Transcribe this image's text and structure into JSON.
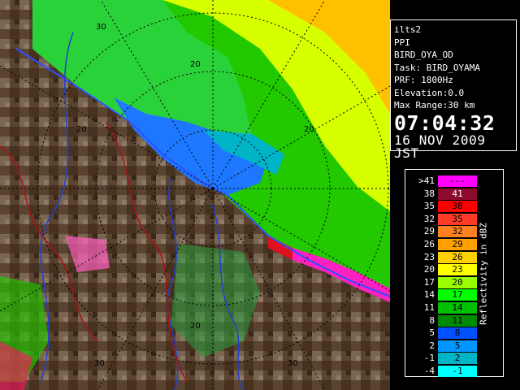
{
  "info_panel": {
    "site": "ilts2",
    "scan_type": "PPI",
    "product": "BIRD_OYA_OD",
    "task": "Task: BIRD_OYAMA",
    "prf": "PRF: 1800Hz",
    "elevation": "Elevation:0.0",
    "max_range": "Max Range:30 km",
    "time": "07:04:32",
    "date": "16 NOV 2009 JST"
  },
  "legend": {
    "title": "Reflectivity in dBZ",
    "rows": [
      {
        "low": ">41",
        "high": "---",
        "color": "#ff00ff",
        "text": "#000000"
      },
      {
        "low": "38",
        "high": "41",
        "color": "#8c0a2e",
        "text": "#ffffff"
      },
      {
        "low": "35",
        "high": "38",
        "color": "#ff0000",
        "text": "#000000"
      },
      {
        "low": "32",
        "high": "35",
        "color": "#ff3c28",
        "text": "#000000"
      },
      {
        "low": "29",
        "high": "32",
        "color": "#ff8020",
        "text": "#000000"
      },
      {
        "low": "26",
        "high": "29",
        "color": "#ffa000",
        "text": "#000000"
      },
      {
        "low": "23",
        "high": "26",
        "color": "#ffd000",
        "text": "#000000"
      },
      {
        "low": "20",
        "high": "23",
        "color": "#ffff00",
        "text": "#000000"
      },
      {
        "low": "17",
        "high": "20",
        "color": "#9aff00",
        "text": "#000000"
      },
      {
        "low": "14",
        "high": "17",
        "color": "#00ff00",
        "text": "#000000"
      },
      {
        "low": "11",
        "high": "14",
        "color": "#00c000",
        "text": "#000000"
      },
      {
        "low": "8",
        "high": "11",
        "color": "#008c00",
        "text": "#000000"
      },
      {
        "low": "5",
        "high": "8",
        "color": "#0050ff",
        "text": "#000000"
      },
      {
        "low": "2",
        "high": "5",
        "color": "#0096ff",
        "text": "#000000"
      },
      {
        "low": "-1",
        "high": "2",
        "color": "#00b4c8",
        "text": "#000000"
      },
      {
        "low": "-4",
        "high": "-1",
        "color": "#00ffff",
        "text": "#000000"
      }
    ]
  },
  "range_labels": [
    "30",
    "20",
    "20",
    "20",
    "20",
    "30",
    "30"
  ]
}
